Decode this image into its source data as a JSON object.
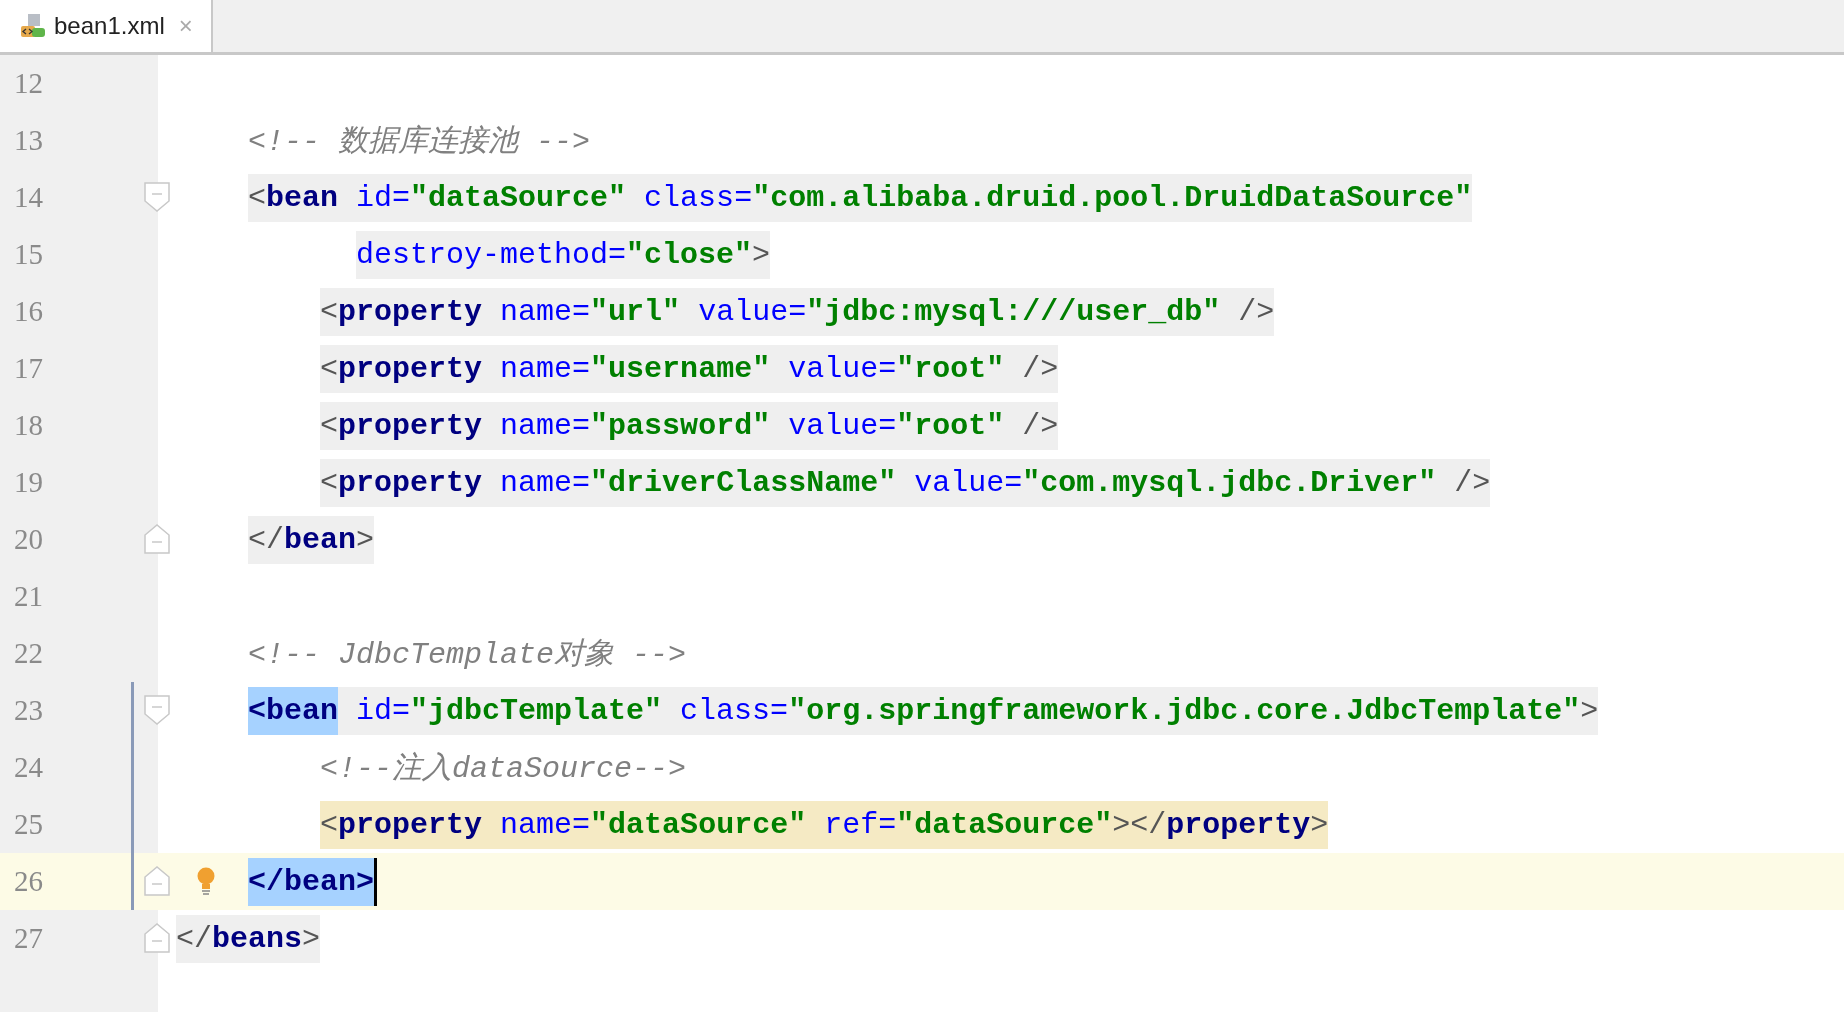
{
  "tabs": [
    {
      "label": "bean1.xml",
      "close": "×",
      "selected": true
    }
  ],
  "lines": [
    {
      "number": "12",
      "fold_start": false,
      "fold_end": false,
      "current_line": false,
      "scope_bar": false,
      "bulb": false,
      "caret": false
    },
    {
      "number": "13",
      "fold_start": false,
      "fold_end": false,
      "scope_highlight": false,
      "usage_highlight": false,
      "current_line": false,
      "scope_bar": false,
      "bulb": false,
      "caret": false,
      "tokens": [
        {
          "kind": "comment",
          "text": "    <!-- 数据库连接池 -->"
        }
      ]
    },
    {
      "number": "14",
      "fold_start": true,
      "fold_end": false,
      "scope_highlight": true,
      "usage_highlight": false,
      "current_line": false,
      "scope_bar": false,
      "bulb": false,
      "caret": false,
      "tokens": [
        {
          "kind": "punct",
          "text": "    <"
        },
        {
          "kind": "tag",
          "text": "bean"
        },
        {
          "kind": "attr",
          "text": " id="
        },
        {
          "kind": "value",
          "text": "\"dataSource\""
        },
        {
          "kind": "attr",
          "text": " class="
        },
        {
          "kind": "value",
          "text": "\"com.alibaba.druid.pool.DruidDataSource\""
        }
      ]
    },
    {
      "number": "15",
      "fold_start": false,
      "fold_end": false,
      "scope_highlight": true,
      "usage_highlight": false,
      "current_line": false,
      "scope_bar": false,
      "bulb": false,
      "caret": false,
      "tokens": [
        {
          "kind": "attr",
          "text": "          destroy-method="
        },
        {
          "kind": "value",
          "text": "\"close\""
        },
        {
          "kind": "punct",
          "text": ">"
        }
      ]
    },
    {
      "number": "16",
      "fold_start": false,
      "fold_end": false,
      "scope_highlight": true,
      "usage_highlight": false,
      "current_line": false,
      "scope_bar": false,
      "bulb": false,
      "caret": false,
      "tokens": [
        {
          "kind": "punct",
          "text": "        <"
        },
        {
          "kind": "tag",
          "text": "property"
        },
        {
          "kind": "attr",
          "text": " name="
        },
        {
          "kind": "value",
          "text": "\"url\""
        },
        {
          "kind": "attr",
          "text": " value="
        },
        {
          "kind": "value",
          "text": "\"jdbc:mysql:///user_db\""
        },
        {
          "kind": "punct",
          "text": " />"
        }
      ]
    },
    {
      "number": "17",
      "fold_start": false,
      "fold_end": false,
      "scope_highlight": true,
      "usage_highlight": false,
      "current_line": false,
      "scope_bar": false,
      "bulb": false,
      "caret": false,
      "tokens": [
        {
          "kind": "punct",
          "text": "        <"
        },
        {
          "kind": "tag",
          "text": "property"
        },
        {
          "kind": "attr",
          "text": " name="
        },
        {
          "kind": "value",
          "text": "\"username\""
        },
        {
          "kind": "attr",
          "text": " value="
        },
        {
          "kind": "value",
          "text": "\"root\""
        },
        {
          "kind": "punct",
          "text": " />"
        }
      ]
    },
    {
      "number": "18",
      "fold_start": false,
      "fold_end": false,
      "scope_highlight": true,
      "usage_highlight": false,
      "current_line": false,
      "scope_bar": false,
      "bulb": false,
      "caret": false,
      "tokens": [
        {
          "kind": "punct",
          "text": "        <"
        },
        {
          "kind": "tag",
          "text": "property"
        },
        {
          "kind": "attr",
          "text": " name="
        },
        {
          "kind": "value",
          "text": "\"password\""
        },
        {
          "kind": "attr",
          "text": " value="
        },
        {
          "kind": "value",
          "text": "\"root\""
        },
        {
          "kind": "punct",
          "text": " />"
        }
      ]
    },
    {
      "number": "19",
      "fold_start": false,
      "fold_end": false,
      "scope_highlight": true,
      "usage_highlight": false,
      "current_line": false,
      "scope_bar": false,
      "bulb": false,
      "caret": false,
      "tokens": [
        {
          "kind": "punct",
          "text": "        <"
        },
        {
          "kind": "tag",
          "text": "property"
        },
        {
          "kind": "attr",
          "text": " name="
        },
        {
          "kind": "value",
          "text": "\"driverClassName\""
        },
        {
          "kind": "attr",
          "text": " value="
        },
        {
          "kind": "value",
          "text": "\"com.mysql.jdbc.Driver\""
        },
        {
          "kind": "punct",
          "text": " />"
        }
      ]
    },
    {
      "number": "20",
      "fold_start": false,
      "fold_end": true,
      "scope_highlight": true,
      "usage_highlight": false,
      "current_line": false,
      "scope_bar": false,
      "bulb": false,
      "caret": false,
      "tokens": [
        {
          "kind": "punct",
          "text": "    </"
        },
        {
          "kind": "tag",
          "text": "bean"
        },
        {
          "kind": "punct",
          "text": ">"
        }
      ]
    },
    {
      "number": "21",
      "fold_start": false,
      "fold_end": false,
      "current_line": false,
      "scope_bar": false,
      "bulb": false,
      "caret": false
    },
    {
      "number": "22",
      "fold_start": false,
      "fold_end": false,
      "scope_highlight": false,
      "usage_highlight": false,
      "current_line": false,
      "scope_bar": false,
      "bulb": false,
      "caret": false,
      "tokens": [
        {
          "kind": "comment",
          "text": "    <!-- JdbcTemplate对象 -->"
        }
      ]
    },
    {
      "number": "23",
      "fold_start": true,
      "fold_end": false,
      "scope_highlight": true,
      "usage_highlight": false,
      "current_line": false,
      "scope_bar": true,
      "bulb": false,
      "caret": false,
      "tokens": [
        {
          "kind": "match",
          "text": "    <bean"
        },
        {
          "kind": "attr",
          "text": " id="
        },
        {
          "kind": "value",
          "text": "\"jdbcTemplate\""
        },
        {
          "kind": "attr",
          "text": " class="
        },
        {
          "kind": "value",
          "text": "\"org.springframework.jdbc.core.JdbcTemplate\""
        },
        {
          "kind": "punct",
          "text": ">"
        }
      ]
    },
    {
      "number": "24",
      "fold_start": false,
      "fold_end": false,
      "scope_highlight": false,
      "usage_highlight": false,
      "current_line": false,
      "scope_bar": true,
      "bulb": false,
      "caret": false,
      "tokens": [
        {
          "kind": "comment",
          "text": "        <!--注入dataSource-->"
        }
      ]
    },
    {
      "number": "25",
      "fold_start": false,
      "fold_end": false,
      "scope_highlight": false,
      "usage_highlight": true,
      "current_line": false,
      "scope_bar": true,
      "bulb": false,
      "caret": false,
      "tokens": [
        {
          "kind": "punct",
          "text": "        <"
        },
        {
          "kind": "tag",
          "text": "property"
        },
        {
          "kind": "attr",
          "text": " name="
        },
        {
          "kind": "value",
          "text": "\"dataSource\""
        },
        {
          "kind": "attr",
          "text": " ref="
        },
        {
          "kind": "value",
          "text": "\"dataSource\""
        },
        {
          "kind": "punct",
          "text": "></"
        },
        {
          "kind": "tag",
          "text": "property"
        },
        {
          "kind": "punct",
          "text": ">"
        }
      ]
    },
    {
      "number": "26",
      "fold_start": false,
      "fold_end": true,
      "scope_highlight": false,
      "usage_highlight": false,
      "current_line": true,
      "scope_bar": true,
      "bulb": true,
      "caret": true,
      "tokens": [
        {
          "kind": "match",
          "text": "    </bean>"
        }
      ]
    },
    {
      "number": "27",
      "fold_start": false,
      "fold_end": true,
      "scope_highlight": true,
      "usage_highlight": false,
      "current_line": false,
      "scope_bar": false,
      "bulb": false,
      "caret": false,
      "tokens": [
        {
          "kind": "punct",
          "text": "</"
        },
        {
          "kind": "tag",
          "text": "beans"
        },
        {
          "kind": "punct",
          "text": ">"
        }
      ]
    }
  ]
}
